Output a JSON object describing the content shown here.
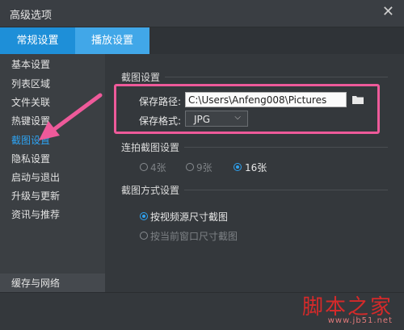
{
  "window": {
    "title": "高级选项",
    "close_glyph": "✕"
  },
  "tabs": [
    {
      "label": "常规设置",
      "active": true
    },
    {
      "label": "播放设置",
      "active": false
    }
  ],
  "sidebar": {
    "items": [
      {
        "label": "基本设置"
      },
      {
        "label": "列表区域"
      },
      {
        "label": "文件关联"
      },
      {
        "label": "热键设置"
      },
      {
        "label": "截图设置",
        "active": true
      },
      {
        "label": "隐私设置"
      },
      {
        "label": "启动与退出"
      },
      {
        "label": "升级与更新"
      },
      {
        "label": "资讯与推荐"
      }
    ],
    "bottom_item": "缓存与网络"
  },
  "screenshot_settings": {
    "title": "截图设置",
    "path_label": "保存路径:",
    "path_value": "C:\\Users\\Anfeng008\\Pictures",
    "format_label": "保存格式:",
    "format_value": "JPG"
  },
  "burst_settings": {
    "title": "连拍截图设置",
    "options": [
      "4张",
      "9张",
      "16张"
    ],
    "selected": "16张"
  },
  "capture_mode": {
    "title": "截图方式设置",
    "options": [
      "按视频源尺寸截图",
      "按当前窗口尺寸截图"
    ],
    "selected": "按视频源尺寸截图"
  },
  "watermark": {
    "text": "脚本之家",
    "url": "www.jb51.net"
  },
  "colors": {
    "accent": "#2ea3f2",
    "tab_active": "#1e8fd8",
    "highlight": "#ee5a9a",
    "background": "#34383c"
  },
  "icons": {
    "folder": "folder-icon",
    "dropdown": "chevron-down-icon",
    "annotation_arrow": "pink-arrow-icon"
  }
}
